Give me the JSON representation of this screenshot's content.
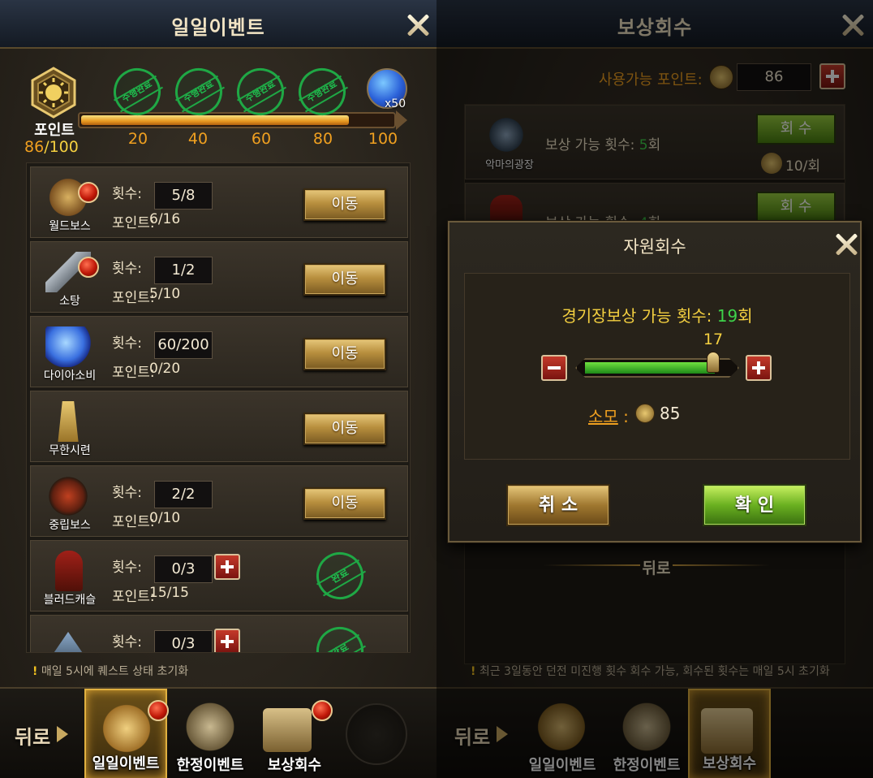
{
  "left": {
    "title": "일일이벤트",
    "points_label": "포인트",
    "points_current": "86",
    "points_max": "/100",
    "progress_fraction": 0.86,
    "milestones": [
      {
        "value": "20",
        "stamp": "수행완료",
        "reward_count": "x"
      },
      {
        "value": "40",
        "stamp": "수행완료",
        "reward_count": "1"
      },
      {
        "value": "60",
        "stamp": "수행완료",
        "reward_count": "1"
      },
      {
        "value": "80",
        "stamp": "수행완료",
        "reward_count": "1"
      },
      {
        "value": "100",
        "reward_count": "x50"
      }
    ],
    "count_label": "횟수:",
    "point_label": "포인트:",
    "go_label": "이동",
    "done_stamp": "완료",
    "tasks": [
      {
        "name": "월드보스",
        "count": "5/8",
        "points": "6/16"
      },
      {
        "name": "소탕",
        "count": "1/2",
        "points": "5/10"
      },
      {
        "name": "다이아소비",
        "count": "60/200",
        "points": "0/20"
      },
      {
        "name": "무한시련"
      },
      {
        "name": "중립보스",
        "count": "2/2",
        "points": "0/10"
      },
      {
        "name": "블러드캐슬",
        "count": "0/3",
        "points": "15/15"
      },
      {
        "name": "",
        "count": "0/3"
      }
    ],
    "notice": "매일 5시에 퀘스트 상태 초기화"
  },
  "tabs": {
    "back": "뒤로",
    "daily": "일일이벤트",
    "limited": "한정이벤트",
    "reward": "보상회수"
  },
  "right": {
    "title": "보상회수",
    "available_points_label": "사용가능 포인트:",
    "available_points": "86",
    "reward_rows": [
      {
        "name": "악마의광장",
        "label": "보상 가능 횟수: ",
        "value": "5",
        "unit": "회",
        "button": "회 수",
        "cost": "10/회"
      },
      {
        "label": "보상 가능 횟수: ",
        "value": "4",
        "unit": "회",
        "button": "회 수"
      }
    ],
    "back_label": "뒤로",
    "notice": "최근 3일동안 던전 미진행 횟수 회수 가능, 회수된 횟수는 매일 5시 초기화"
  },
  "modal": {
    "title": "자원회수",
    "available_label": "경기장보상 가능 횟수: ",
    "available_value": "19",
    "available_unit": "회",
    "slider_value": "17",
    "slider_fraction": 0.89,
    "cost_label": "소모",
    "cost_sep": ":",
    "cost_value": "85",
    "cancel_label": "취 소",
    "confirm_label": "확 인"
  },
  "colors": {
    "gold": "#e6c77a",
    "green_value": "#3ed24a",
    "orange_text": "#f0a020",
    "yellow_text": "#f4d040"
  }
}
